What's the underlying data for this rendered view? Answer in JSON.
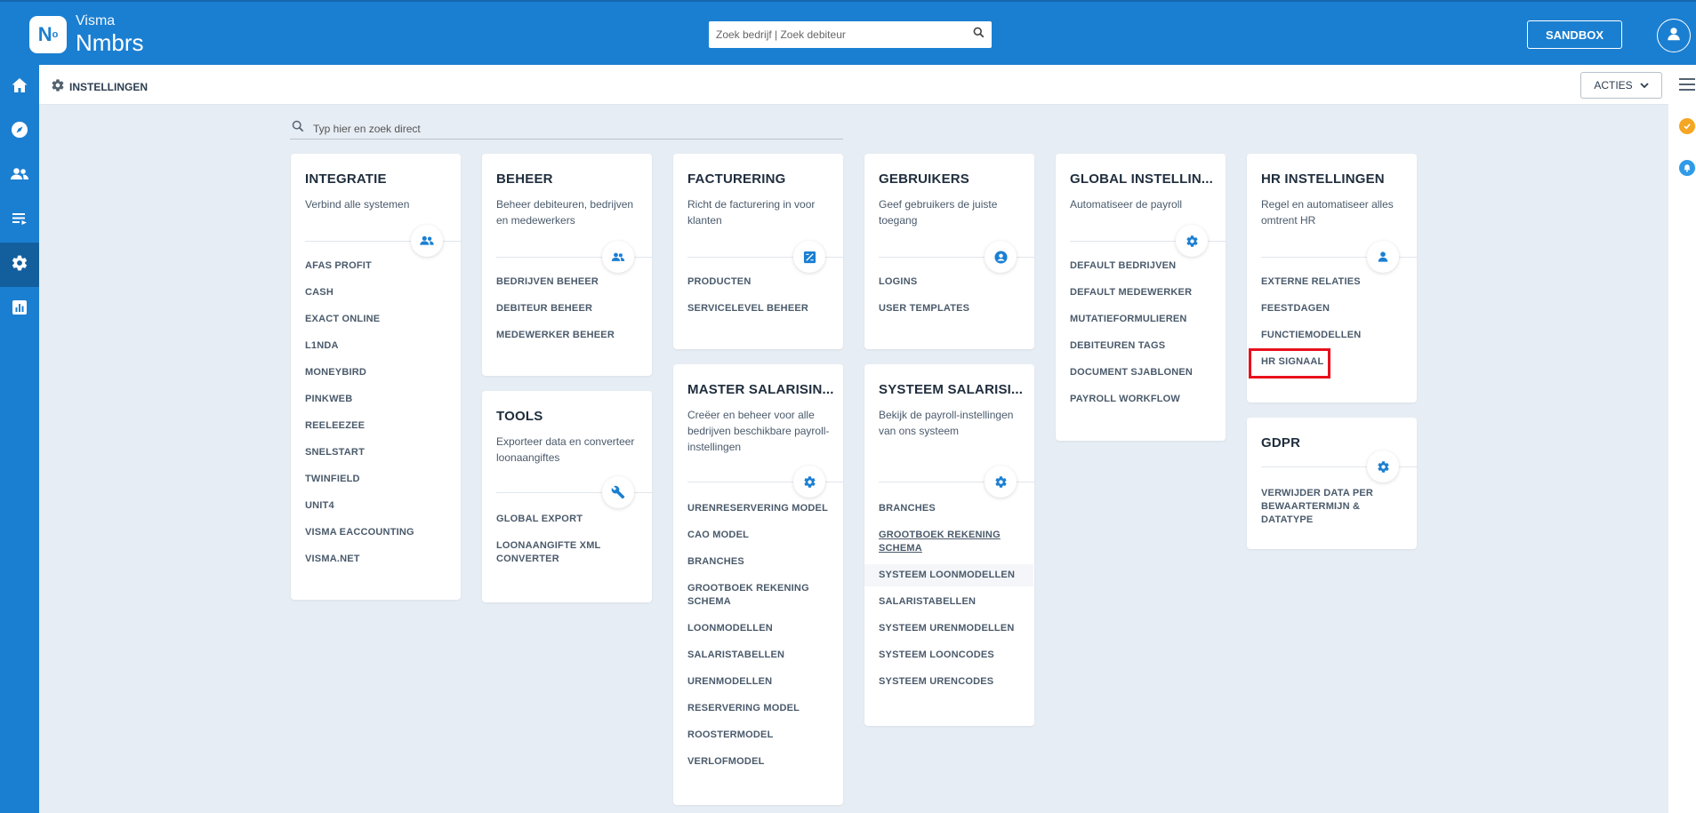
{
  "topbar": {
    "logo_mark": "N",
    "logo_mark_sup": "o",
    "brand_line1": "Visma",
    "brand_line2": "Nmbrs",
    "search_placeholder": "Zoek bedrijf | Zoek debiteur",
    "sandbox_label": "SANDBOX"
  },
  "sidebar": {
    "items": [
      {
        "icon": "home-icon"
      },
      {
        "icon": "compass-icon"
      },
      {
        "icon": "people-icon"
      },
      {
        "icon": "list-icon"
      },
      {
        "icon": "gear-icon",
        "active": true
      },
      {
        "icon": "chart-icon"
      }
    ]
  },
  "subheader": {
    "title": "INSTELLINGEN",
    "actions_label": "ACTIES"
  },
  "content_search": {
    "placeholder": "Typ hier en zoek direct"
  },
  "colors": {
    "brand": "#1b7fd1",
    "highlight": "#e8101c",
    "rail_yellow": "#f5a623",
    "rail_blue": "#2f9be8"
  },
  "cards": {
    "integratie": {
      "title": "INTEGRATIE",
      "description": "Verbind alle systemen",
      "icon": "people-icon",
      "links": [
        "AFAS PROFIT",
        "CASH",
        "EXACT ONLINE",
        "L1NDA",
        "MONEYBIRD",
        "PINKWEB",
        "REELEEZEE",
        "SNELSTART",
        "TWINFIELD",
        "UNIT4",
        "VISMA EACCOUNTING",
        "VISMA.NET"
      ]
    },
    "beheer": {
      "title": "BEHEER",
      "description": "Beheer debiteuren, bedrijven en medewerkers",
      "icon": "people-icon",
      "links": [
        "BEDRIJVEN BEHEER",
        "DEBITEUR BEHEER",
        "MEDEWERKER BEHEER"
      ]
    },
    "tools": {
      "title": "TOOLS",
      "description": "Exporteer data en converteer loonaangiftes",
      "icon": "wrench-icon",
      "links": [
        "GLOBAL EXPORT",
        "LOONAANGIFTE XML CONVERTER"
      ]
    },
    "facturering": {
      "title": "FACTURERING",
      "description": "Richt de facturering in voor klanten",
      "icon": "invoice-icon",
      "links": [
        "PRODUCTEN",
        "SERVICELEVEL BEHEER"
      ]
    },
    "master_salarisin": {
      "title": "MASTER SALARISIN...",
      "description": "Creëer en beheer voor alle bedrijven beschikbare payroll-instellingen",
      "icon": "gear-icon",
      "links": [
        "URENRESERVERING MODEL",
        "CAO MODEL",
        "BRANCHES",
        "GROOTBOEK REKENING SCHEMA",
        "LOONMODELLEN",
        "SALARISTABELLEN",
        "URENMODELLEN",
        "RESERVERING MODEL",
        "ROOSTERMODEL",
        "VERLOFMODEL"
      ]
    },
    "gebruikers": {
      "title": "GEBRUIKERS",
      "description": "Geef gebruikers de juiste toegang",
      "icon": "user-circle-icon",
      "links": [
        "LOGINS",
        "USER TEMPLATES"
      ]
    },
    "systeem_salarisi": {
      "title": "SYSTEEM SALARISI...",
      "description": "Bekijk de payroll-instellingen van ons systeem",
      "icon": "gear-icon",
      "links": [
        "BRANCHES",
        "GROOTBOEK REKENING SCHEMA",
        "SYSTEEM LOONMODELLEN",
        "SALARISTABELLEN",
        "SYSTEEM URENMODELLEN",
        "SYSTEEM LOONCODES",
        "SYSTEEM URENCODES"
      ]
    },
    "global_instellin": {
      "title": "GLOBAL INSTELLIN...",
      "description": "Automatiseer de payroll",
      "icon": "gear-icon",
      "links": [
        "DEFAULT BEDRIJVEN",
        "DEFAULT MEDEWERKER",
        "MUTATIEFORMULIEREN",
        "DEBITEUREN TAGS",
        "DOCUMENT SJABLONEN",
        "PAYROLL WORKFLOW"
      ]
    },
    "hr_instellingen": {
      "title": "HR INSTELLINGEN",
      "description": "Regel en automatiseer alles omtrent HR",
      "icon": "person-icon",
      "links": [
        "EXTERNE RELATIES",
        "FEESTDAGEN",
        "FUNCTIEMODELLEN",
        "HR SIGNAAL"
      ]
    },
    "gdpr": {
      "title": "GDPR",
      "description": "",
      "icon": "gear-icon",
      "links": [
        "VERWIJDER DATA PER BEWAARTERMIJN & DATATYPE"
      ]
    }
  }
}
